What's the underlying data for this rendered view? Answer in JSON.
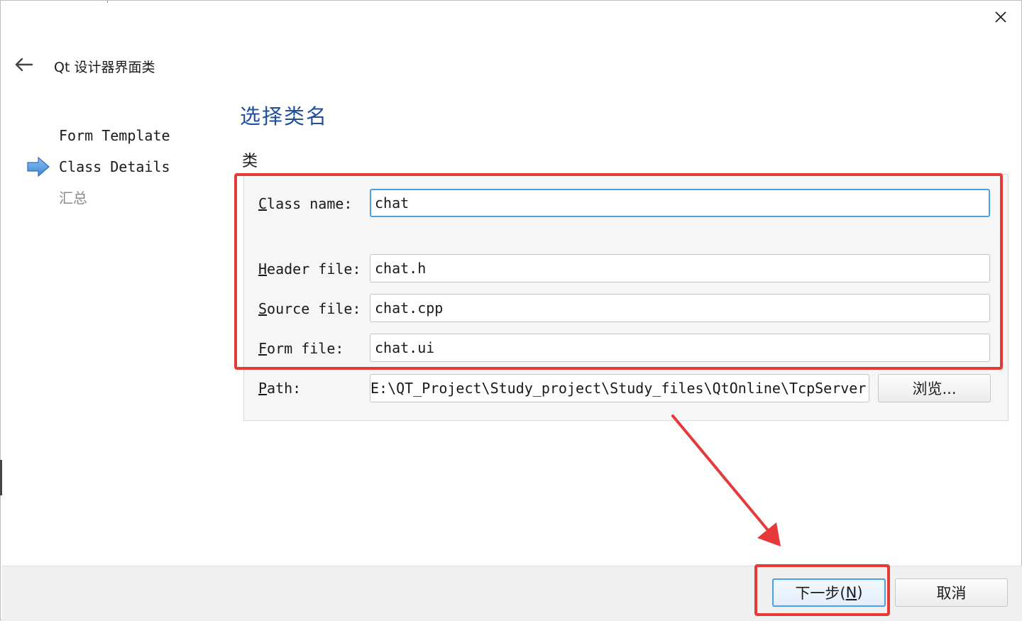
{
  "wizard": {
    "title": "Qt 设计器界面类",
    "steps": [
      {
        "label": "Form Template",
        "state": "done"
      },
      {
        "label": "Class Details",
        "state": "current"
      },
      {
        "label": "汇总",
        "state": "pending"
      }
    ]
  },
  "page": {
    "title": "选择类名",
    "group_title": "类"
  },
  "fields": {
    "class_name": {
      "mnemonic": "C",
      "label_rest": "lass name:",
      "value": "chat"
    },
    "header_file": {
      "mnemonic": "H",
      "label_rest": "eader file:",
      "value": "chat.h"
    },
    "source_file": {
      "mnemonic": "S",
      "label_rest": "ource file:",
      "value": "chat.cpp"
    },
    "form_file": {
      "mnemonic": "F",
      "label_rest": "orm file:",
      "value": "chat.ui"
    },
    "path": {
      "mnemonic": "P",
      "label_rest": "ath:",
      "value": "E:\\QT_Project\\Study_project\\Study_files\\QtOnline\\TcpServer"
    }
  },
  "buttons": {
    "browse": "浏览...",
    "next_prefix": "下一步(",
    "next_mnemonic": "N",
    "next_suffix": ")",
    "cancel": "取消"
  },
  "colors": {
    "accent": "#4aa0e6",
    "title_blue": "#1e4e9c",
    "annotation_red": "#e63a3a"
  },
  "icons": {
    "close": "close-icon",
    "back": "back-arrow-icon",
    "current_step": "step-arrow-icon"
  }
}
